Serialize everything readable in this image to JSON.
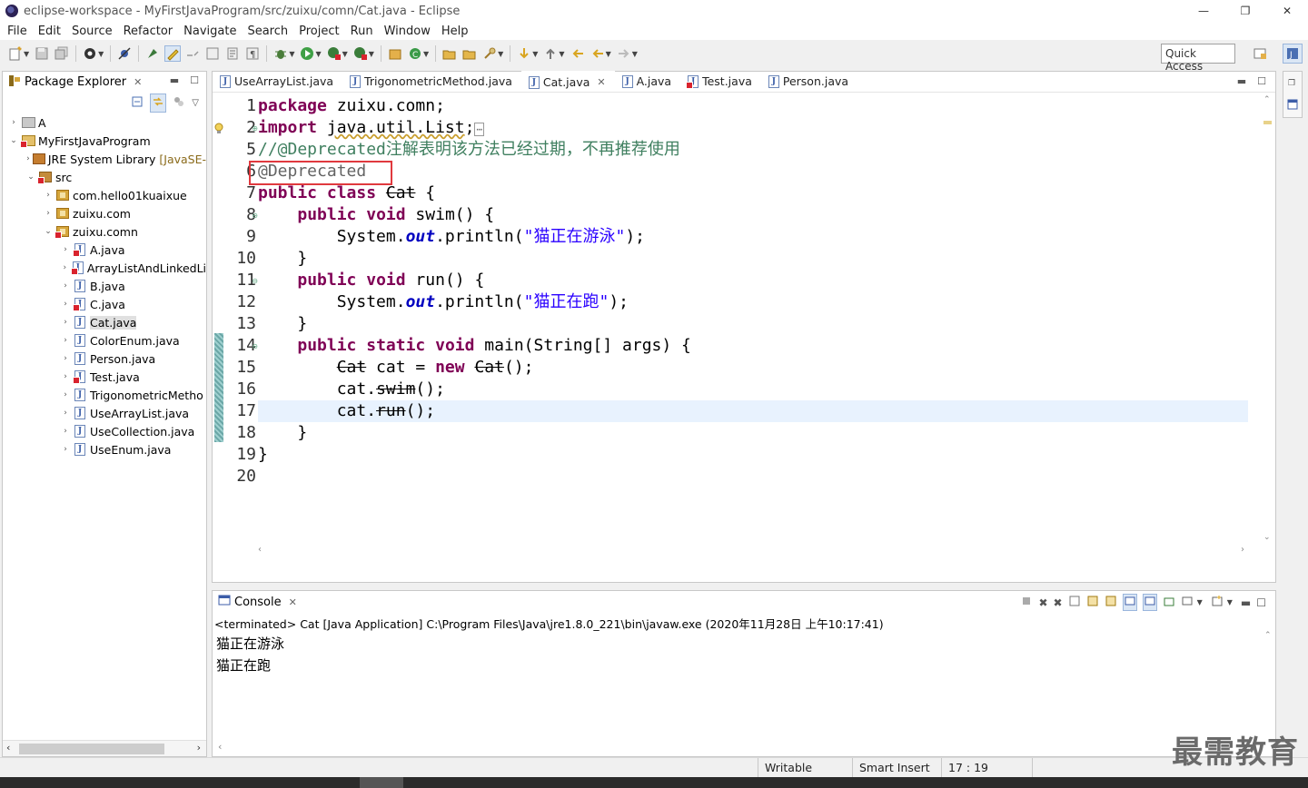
{
  "window": {
    "title": "eclipse-workspace - MyFirstJavaProgram/src/zuixu/comn/Cat.java - Eclipse",
    "controls": {
      "minimize": "—",
      "restore": "❐",
      "close": "✕"
    }
  },
  "menu": [
    "File",
    "Edit",
    "Source",
    "Refactor",
    "Navigate",
    "Search",
    "Project",
    "Run",
    "Window",
    "Help"
  ],
  "quick_access": {
    "placeholder": "Quick Access"
  },
  "package_explorer": {
    "title": "Package Explorer",
    "items": [
      {
        "label": "A",
        "depth": 0,
        "arrow": "›",
        "icon": "project-closed-icon"
      },
      {
        "label": "MyFirstJavaProgram",
        "depth": 0,
        "arrow": "⌄",
        "icon": "project-error-icon"
      },
      {
        "label": "JRE System Library",
        "suffix": "[JavaSE-",
        "depth": 1,
        "arrow": "›",
        "icon": "jre-library-icon"
      },
      {
        "label": "src",
        "depth": 1,
        "arrow": "⌄",
        "icon": "source-folder-error-icon"
      },
      {
        "label": "com.hello01kuaixue",
        "depth": 2,
        "arrow": "›",
        "icon": "package-icon"
      },
      {
        "label": "zuixu.com",
        "depth": 2,
        "arrow": "›",
        "icon": "package-icon"
      },
      {
        "label": "zuixu.comn",
        "depth": 2,
        "arrow": "⌄",
        "icon": "package-error-icon"
      },
      {
        "label": "A.java",
        "depth": 3,
        "arrow": "›",
        "icon": "java-file-error-icon"
      },
      {
        "label": "ArrayListAndLinkedLi",
        "depth": 3,
        "arrow": "›",
        "icon": "java-file-error-icon"
      },
      {
        "label": "B.java",
        "depth": 3,
        "arrow": "›",
        "icon": "java-file-icon"
      },
      {
        "label": "C.java",
        "depth": 3,
        "arrow": "›",
        "icon": "java-file-error-icon"
      },
      {
        "label": "Cat.java",
        "depth": 3,
        "arrow": "›",
        "icon": "java-file-icon",
        "selected": true
      },
      {
        "label": "ColorEnum.java",
        "depth": 3,
        "arrow": "›",
        "icon": "java-file-icon"
      },
      {
        "label": "Person.java",
        "depth": 3,
        "arrow": "›",
        "icon": "java-file-icon"
      },
      {
        "label": "Test.java",
        "depth": 3,
        "arrow": "›",
        "icon": "java-file-error-icon"
      },
      {
        "label": "TrigonometricMetho",
        "depth": 3,
        "arrow": "›",
        "icon": "java-file-icon"
      },
      {
        "label": "UseArrayList.java",
        "depth": 3,
        "arrow": "›",
        "icon": "java-file-icon"
      },
      {
        "label": "UseCollection.java",
        "depth": 3,
        "arrow": "›",
        "icon": "java-file-icon"
      },
      {
        "label": "UseEnum.java",
        "depth": 3,
        "arrow": "›",
        "icon": "java-file-icon"
      }
    ]
  },
  "editor": {
    "tabs": [
      {
        "label": "UseArrayList.java",
        "icon": "java-file-icon",
        "active": false
      },
      {
        "label": "TrigonometricMethod.java",
        "icon": "java-file-icon",
        "active": false
      },
      {
        "label": "Cat.java",
        "icon": "java-file-icon",
        "active": true,
        "close": "✕"
      },
      {
        "label": "A.java",
        "icon": "java-file-icon",
        "active": false
      },
      {
        "label": "Test.java",
        "icon": "java-file-error-icon",
        "active": false
      },
      {
        "label": "Person.java",
        "icon": "java-file-icon",
        "active": false
      }
    ],
    "line_numbers": [
      "1",
      "2",
      "5",
      "6",
      "7",
      "8",
      "9",
      "10",
      "11",
      "12",
      "13",
      "14",
      "15",
      "16",
      "17",
      "18",
      "19",
      "20"
    ],
    "fold_markers": [
      "⊕",
      "⊖",
      "⊖",
      "⊖"
    ],
    "code": {
      "l1": {
        "kw": "package",
        "rest": " zuixu.comn;"
      },
      "l2": {
        "kw": "import",
        "rest_a": " ",
        "ul": "java.util.List",
        "rest_b": ";",
        "box": "⋯"
      },
      "l5": {
        "comment": "//@Deprecated注解表明该方法已经过期，不再推荐使用"
      },
      "l6": {
        "annotation": "@Deprecated"
      },
      "l7": {
        "kw1": "public",
        "kw2": "class",
        "dep": "Cat",
        "rest": " {"
      },
      "l8": {
        "indent": "    ",
        "kw1": "public",
        "kw2": "void",
        "rest": " swim() {"
      },
      "l9": {
        "indent": "        ",
        "pre": "System.",
        "fld": "out",
        "mid": ".println(",
        "str": "\"猫正在游泳\"",
        "end": ");"
      },
      "l10": {
        "text": "    }"
      },
      "l11": {
        "indent": "    ",
        "kw1": "public",
        "kw2": "void",
        "rest": " run() {"
      },
      "l12": {
        "indent": "        ",
        "pre": "System.",
        "fld": "out",
        "mid": ".println(",
        "str": "\"猫正在跑\"",
        "end": ");"
      },
      "l13": {
        "text": "    }"
      },
      "l14": {
        "indent": "    ",
        "kw1": "public",
        "kw2": "static",
        "kw3": "void",
        "rest": " main(String[] args) {"
      },
      "l15": {
        "indent": "        ",
        "dep1": "Cat",
        "mid": " cat = ",
        "kw": "new",
        "sp": " ",
        "dep2": "Cat",
        "end": "();"
      },
      "l16": {
        "indent": "        ",
        "pre": "cat.",
        "dep": "swim",
        "end": "();"
      },
      "l17": {
        "indent": "        ",
        "pre": "cat.",
        "dep": "run",
        "end": "();"
      },
      "l18": {
        "text": "    }"
      },
      "l19": {
        "text": "}"
      },
      "l20": {
        "text": ""
      }
    }
  },
  "console": {
    "title": "Console",
    "status": "<terminated> Cat [Java Application] C:\\Program Files\\Java\\jre1.8.0_221\\bin\\javaw.exe (2020年11月28日 上午10:17:41)",
    "output": [
      "猫正在游泳",
      "猫正在跑"
    ]
  },
  "statusbar": {
    "writable": "Writable",
    "insert_mode": "Smart Insert",
    "position": "17 : 19"
  },
  "watermark": "最需教育",
  "colors": {
    "keyword": "#7f0055",
    "comment": "#3f7f5f",
    "string": "#2a00ff",
    "field": "#0000c0",
    "annotation": "#646464",
    "highlight_box": "#e0393e",
    "current_line": "#e8f2fe"
  }
}
